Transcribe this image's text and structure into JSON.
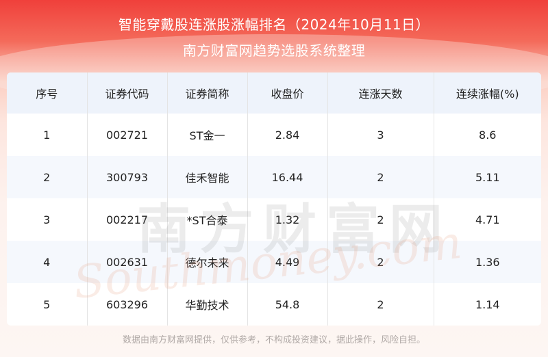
{
  "header": {
    "title": "智能穿戴股连涨股涨幅排名（2024年10月11日）",
    "subtitle": "南方财富网趋势选股系统整理"
  },
  "table": {
    "columns": [
      "序号",
      "证券代码",
      "证券简称",
      "收盘价",
      "连涨天数",
      "连续涨幅(%)"
    ],
    "rows": [
      [
        "1",
        "002721",
        "ST金一",
        "2.84",
        "3",
        "8.6"
      ],
      [
        "2",
        "300793",
        "佳禾智能",
        "16.44",
        "2",
        "5.11"
      ],
      [
        "3",
        "002217",
        "*ST合泰",
        "1.32",
        "2",
        "4.71"
      ],
      [
        "4",
        "002631",
        "德尔未来",
        "4.49",
        "2",
        "1.36"
      ],
      [
        "5",
        "603296",
        "华勤技术",
        "54.8",
        "2",
        "1.14"
      ]
    ]
  },
  "watermark": {
    "cn": "南方财富网",
    "en": "Southmoney.com"
  },
  "footer": {
    "disclaimer": "数据由南方财富网提供，仅供参考，不构成投资建议，据此操作，风险自担。"
  },
  "colors": {
    "header_red": "#f0403b",
    "table_header_bg": "#eef3fb",
    "alt_row_bg": "#f5f8fd"
  }
}
